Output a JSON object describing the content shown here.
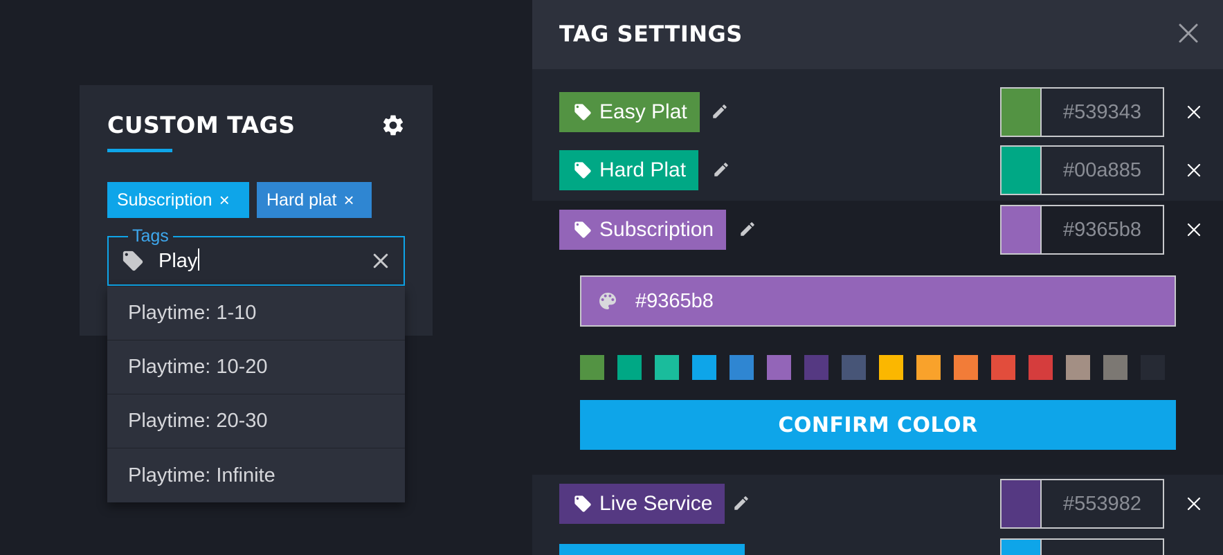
{
  "custom_tags": {
    "title": "CUSTOM TAGS",
    "chips": [
      {
        "label": "Subscription",
        "remove": "×"
      },
      {
        "label": "Hard plat",
        "remove": "×"
      }
    ],
    "field": {
      "label": "Tags",
      "value": "Play"
    },
    "suggestions": [
      "Playtime: 1-10",
      "Playtime: 10-20",
      "Playtime: 20-30",
      "Playtime: Infinite"
    ]
  },
  "tag_settings": {
    "title": "TAG SETTINGS",
    "tags": [
      {
        "name": "Easy Plat",
        "color": "#539343",
        "hex": "#539343"
      },
      {
        "name": "Hard Plat",
        "color": "#00a885",
        "hex": "#00a885"
      },
      {
        "name": "Subscription",
        "color": "#9365b8",
        "hex": "#9365b8"
      },
      {
        "name": "Live Service",
        "color": "#553982",
        "hex": "#553982"
      }
    ],
    "picker": {
      "value": "#9365b8",
      "palette": [
        "#539343",
        "#00a885",
        "#1abc9c",
        "#0ea5e9",
        "#2f86d2",
        "#9365b8",
        "#553982",
        "#475577",
        "#fbb700",
        "#f9a22b",
        "#f27c38",
        "#e24d3c",
        "#d53d3d",
        "#a38f84",
        "#7c7873",
        "#262a34"
      ],
      "confirm_label": "CONFIRM COLOR"
    },
    "partial_tag_color": "#0ea5e9"
  },
  "colors": {
    "accent": "#0ea5e9",
    "background": "#1b1e26",
    "panel": "#222630"
  }
}
